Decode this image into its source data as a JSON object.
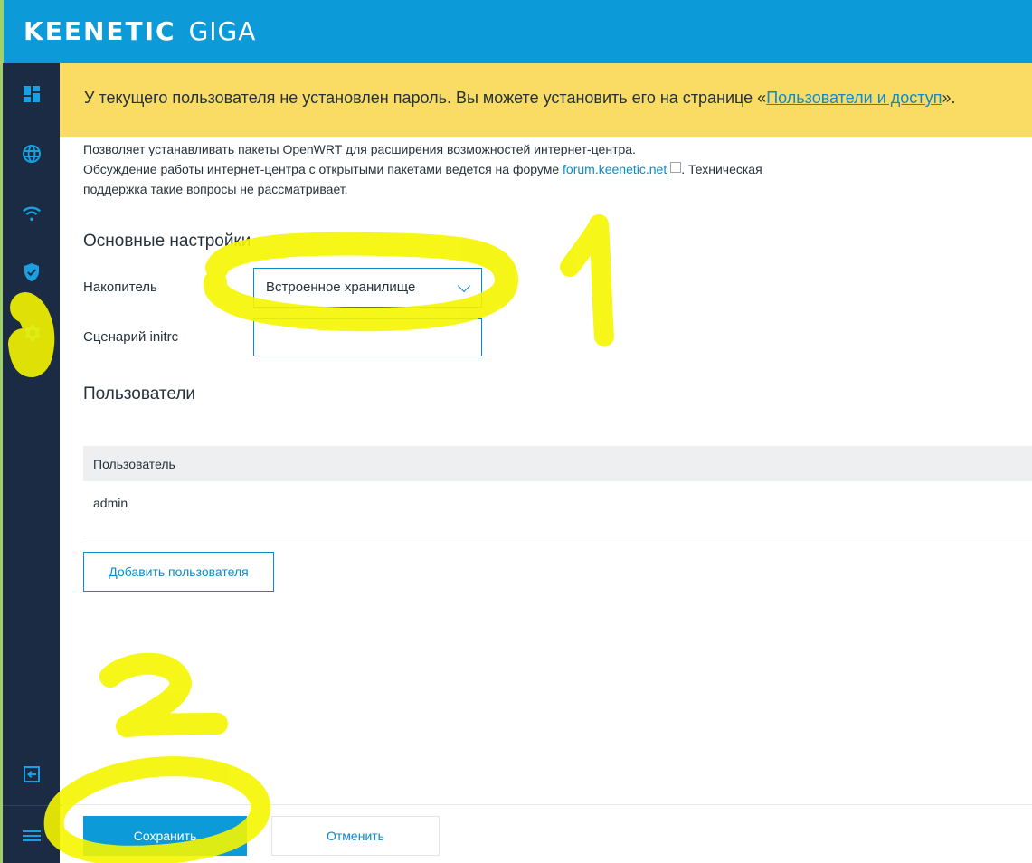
{
  "brand": {
    "name": "KEENETIC",
    "model": "GIGA"
  },
  "sidebar": {
    "items": [
      {
        "icon": "dashboard-icon"
      },
      {
        "icon": "globe-icon"
      },
      {
        "icon": "wifi-icon"
      },
      {
        "icon": "shield-icon"
      },
      {
        "icon": "gear-icon",
        "active": true
      },
      {
        "icon": "logout-icon"
      },
      {
        "icon": "menu-icon"
      }
    ]
  },
  "notice": {
    "text_before": "У текущего пользователя не установлен пароль. Вы можете установить его на странице «",
    "link": "Пользователи и доступ",
    "text_after": "»."
  },
  "description": {
    "line1": "Позволяет устанавливать пакеты OpenWRT для расширения возможностей интернет-центра.",
    "line2_before": "Обсуждение работы интернет-центра с открытыми пакетами ведется на форуме ",
    "link": "forum.keenetic.net",
    "line2_after": ". Техническая",
    "line3": "поддержка такие вопросы не рассматривает."
  },
  "basic_settings": {
    "title": "Основные настройки",
    "storage_label": "Накопитель",
    "storage_value": "Встроенное хранилище",
    "initrc_label": "Сценарий initrc",
    "initrc_value": ""
  },
  "users": {
    "title": "Пользователи",
    "column": "Пользователь",
    "rows": [
      "admin"
    ],
    "add_button": "Добавить пользователя"
  },
  "footer": {
    "save": "Сохранить",
    "cancel": "Отменить"
  },
  "annotations": {
    "mark1": "1",
    "mark2": "2",
    "color": "#f5f500"
  }
}
